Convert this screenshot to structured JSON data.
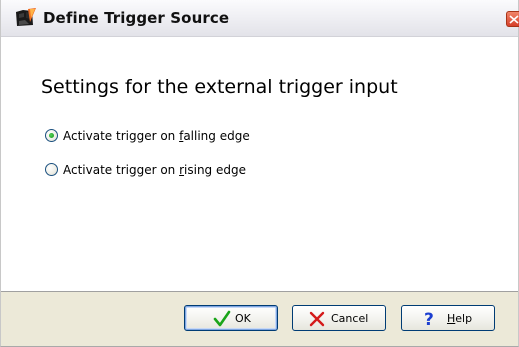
{
  "window": {
    "title": "Define Trigger Source",
    "app_icon": "camera-icon",
    "close_icon": "close-icon"
  },
  "content": {
    "heading": "Settings for the external trigger input",
    "options": [
      {
        "pre": "Activate trigger on ",
        "mnemonic": "f",
        "post": "alling edge",
        "selected": true
      },
      {
        "pre": "Activate trigger on ",
        "mnemonic": "r",
        "post": "ising edge",
        "selected": false
      }
    ]
  },
  "buttons": {
    "ok": {
      "label": "OK",
      "icon": "check-icon",
      "icon_color": "#1aa51a"
    },
    "cancel": {
      "label": "Cancel",
      "icon": "x-icon",
      "icon_color": "#d41a1a"
    },
    "help": {
      "pre": "",
      "mnemonic": "H",
      "post": "elp",
      "icon": "question-icon",
      "icon_color": "#1c3fd0"
    }
  }
}
